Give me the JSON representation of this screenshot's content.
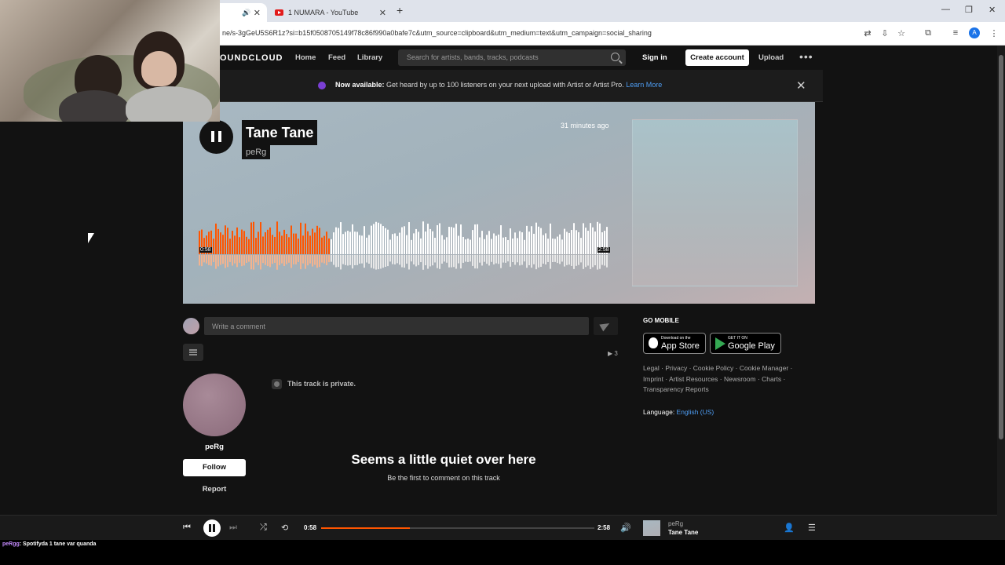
{
  "browser": {
    "tabs": [
      {
        "label": "",
        "active": true
      },
      {
        "label": "1 NUMARA - YouTube",
        "active": false
      }
    ],
    "url": "ne/s-3gGeU5S6R1z?si=b15f0508705149f78c86f990a0bafe7c&utm_source=clipboard&utm_medium=text&utm_campaign=social_sharing",
    "profile_initial": "A"
  },
  "header": {
    "logo": "OUNDCLOUD",
    "nav": [
      "Home",
      "Feed",
      "Library"
    ],
    "search_placeholder": "Search for artists, bands, tracks, podcasts",
    "sign_in": "Sign in",
    "create_account": "Create account",
    "upload": "Upload",
    "more": "•••"
  },
  "banner": {
    "bold": "Now available:",
    "text": " Get heard by up to 100 listeners on your next upload with Artist or Artist Pro. ",
    "link": "Learn More",
    "close": "✕"
  },
  "track": {
    "title": "Tane Tane",
    "artist": "peRg",
    "posted": "31 minutes ago",
    "elapsed": "0:58",
    "duration": "2:58",
    "progress": 0.325
  },
  "comments": {
    "placeholder": "Write a comment",
    "plays": "▶ 3",
    "private_notice": "This track is private.",
    "empty_title": "Seems a little quiet over here",
    "empty_subtitle": "Be the first to comment on this track"
  },
  "artist_panel": {
    "name": "peRg",
    "follow": "Follow",
    "report": "Report"
  },
  "sidebar": {
    "go_mobile": "GO MOBILE",
    "app_store_small": "Download on the",
    "app_store_big": "App Store",
    "google_play_small": "GET IT ON",
    "google_play_big": "Google Play",
    "legal_line1": "Legal · Privacy · Cookie Policy · Cookie Manager ·",
    "legal_line2": "Imprint · Artist Resources · Newsroom · Charts ·",
    "legal_line3": "Transparency Reports",
    "language_label": "Language: ",
    "language_value": "English (US)"
  },
  "player": {
    "elapsed": "0:58",
    "duration": "2:58",
    "progress": 0.325,
    "artist": "peRg",
    "title": "Tane Tane"
  },
  "chat": {
    "user": "peRgg",
    "message": ": Spotifyda 1 tane var quanda"
  },
  "colors": {
    "accent": "#ff5500",
    "background": "#121212",
    "link": "#4e9df3"
  }
}
